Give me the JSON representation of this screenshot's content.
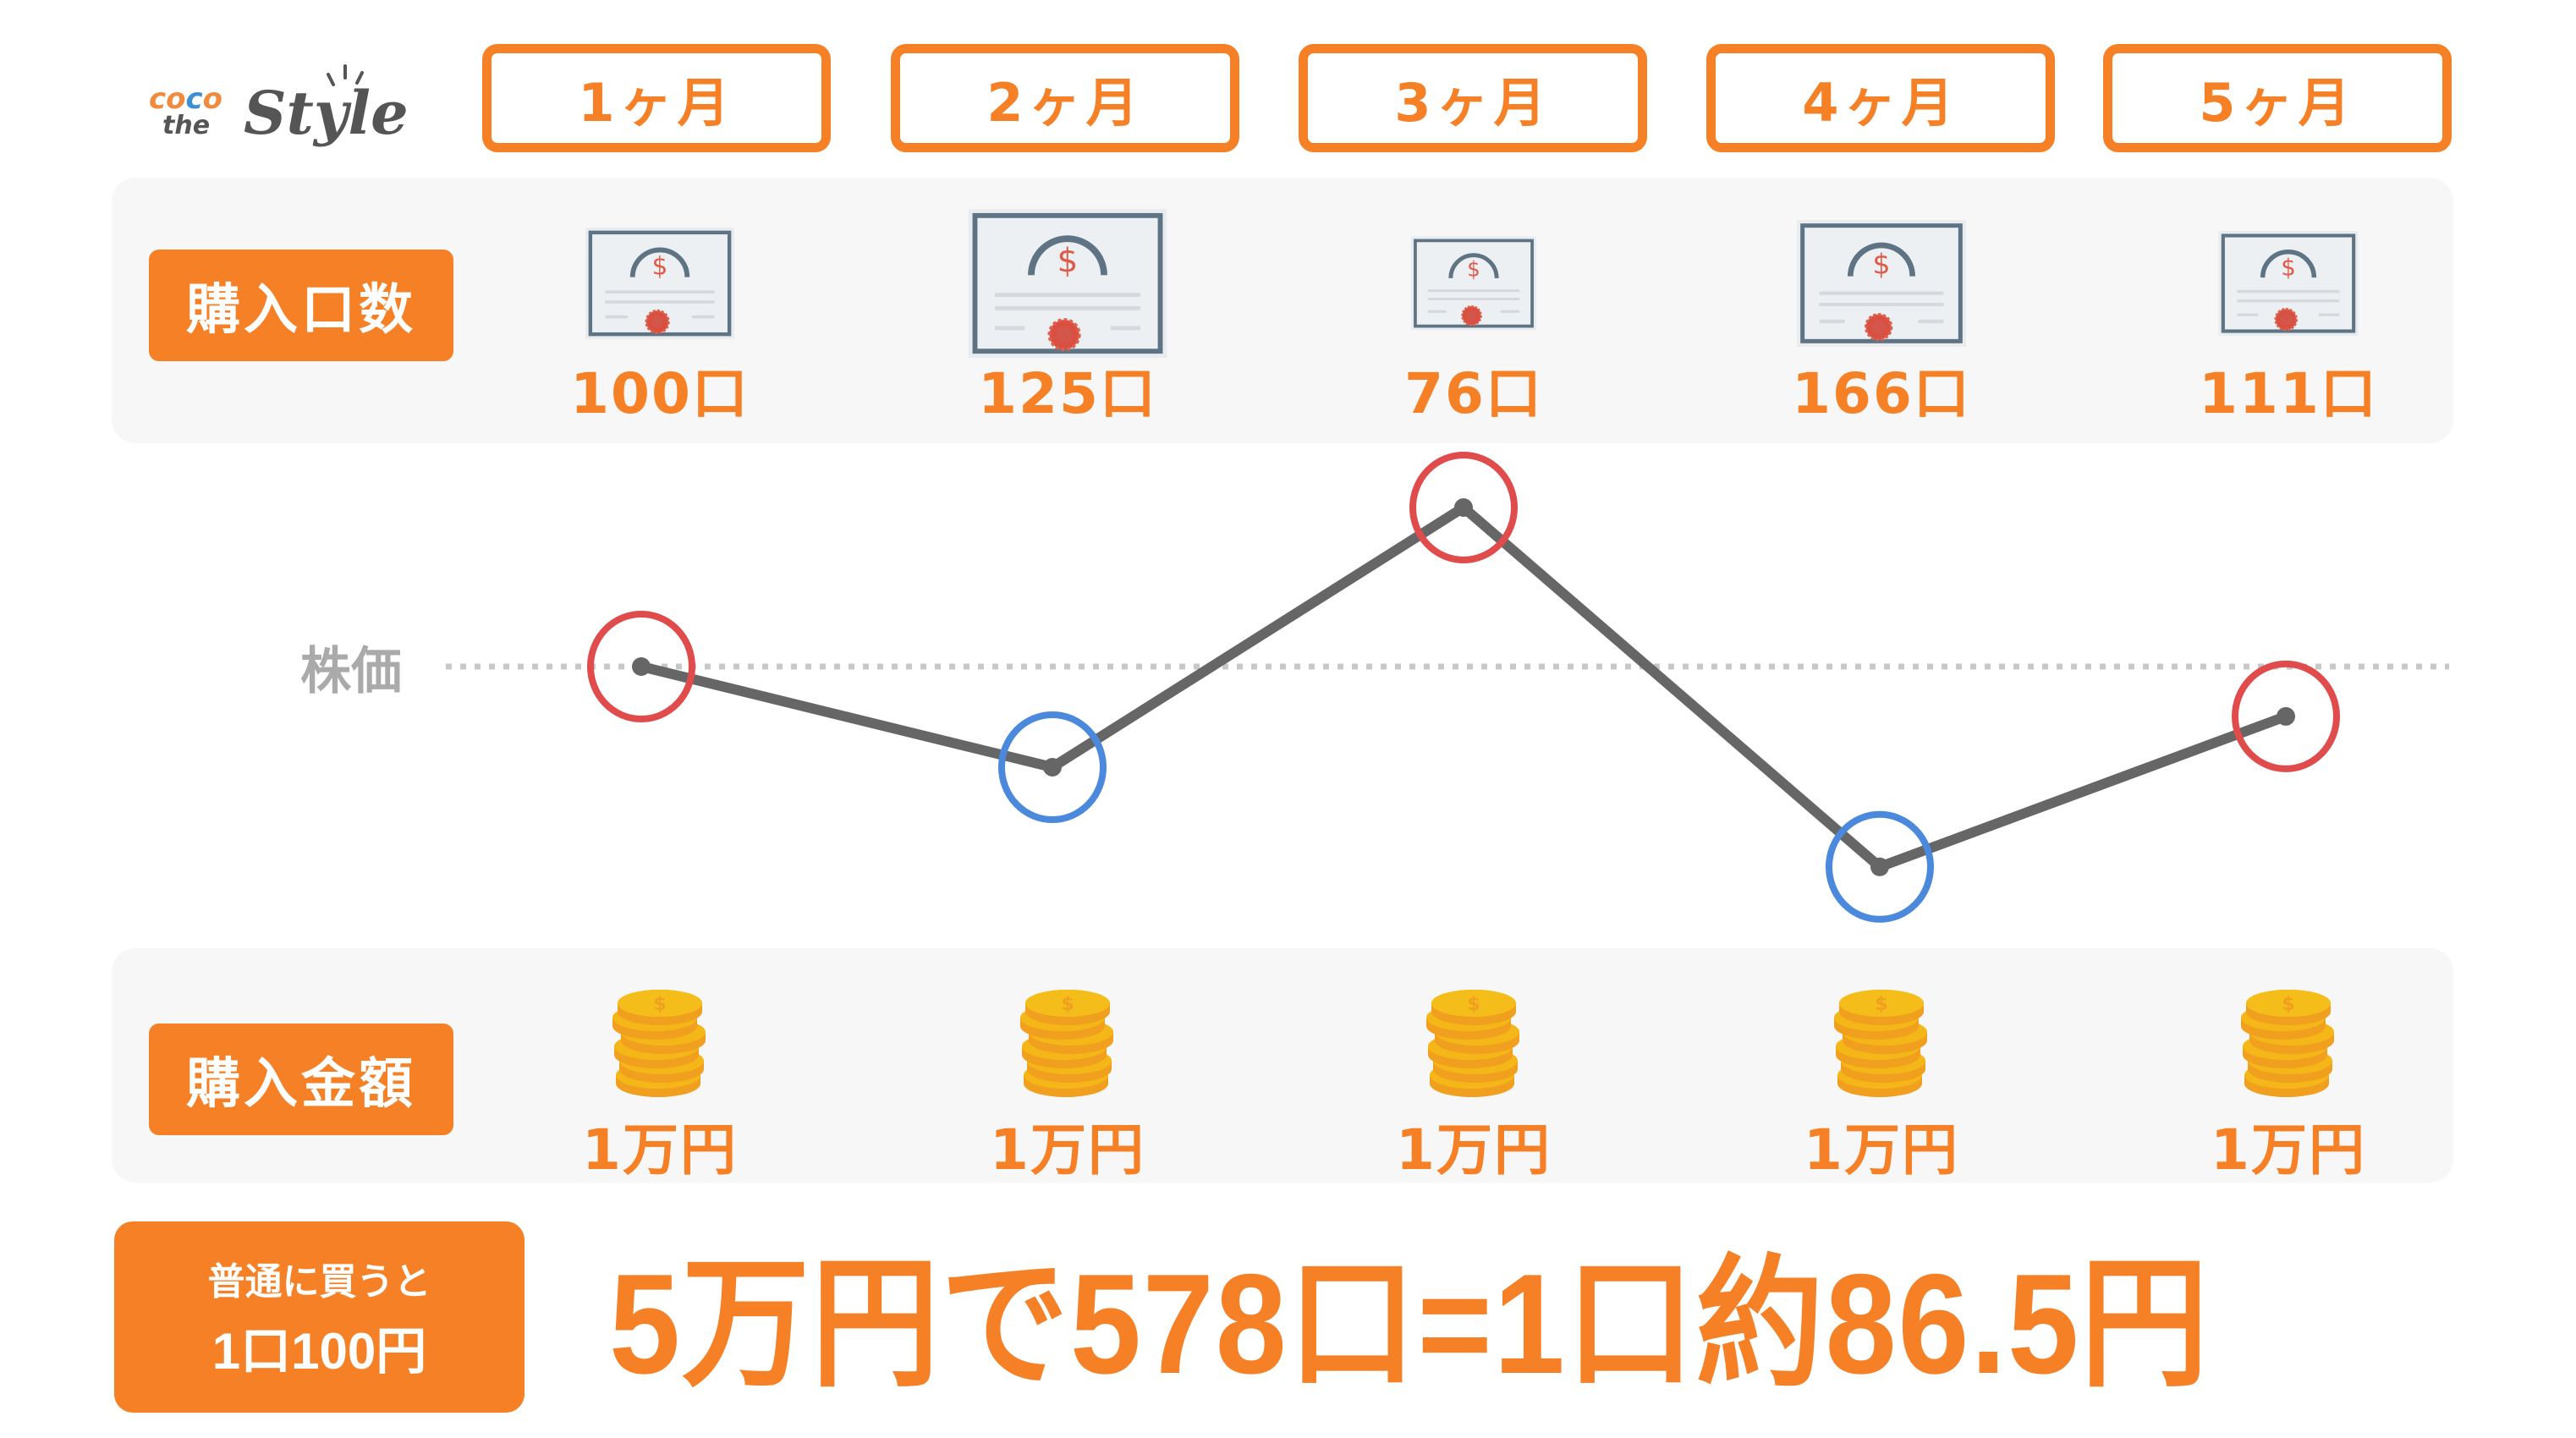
{
  "logo": {
    "part1": "coco",
    "part2": "the",
    "part3": "Style"
  },
  "months": [
    "1ヶ月",
    "2ヶ月",
    "3ヶ月",
    "4ヶ月",
    "5ヶ月"
  ],
  "rows": {
    "shares": {
      "label": "購入口数",
      "values": [
        "100口",
        "125口",
        "76口",
        "166口",
        "111口"
      ],
      "icon": "stock-certificate-icon"
    },
    "amount": {
      "label": "購入金額",
      "values": [
        "1万円",
        "1万円",
        "1万円",
        "1万円",
        "1万円"
      ],
      "icon": "coin-stack-icon"
    }
  },
  "price_label": "株価",
  "normal_purchase": {
    "line1": "普通に買うと",
    "line2": "1口100円"
  },
  "summary": "5万円で578口=1口約86.5円",
  "colors": {
    "accent": "#f58025",
    "high": "#e04b4b",
    "low": "#4a89dc",
    "line": "#666666",
    "baseline": "#c8c8c8"
  },
  "chart_data": {
    "type": "line",
    "title": "",
    "xlabel": "",
    "ylabel": "株価",
    "categories": [
      "1ヶ月",
      "2ヶ月",
      "3ヶ月",
      "4ヶ月",
      "5ヶ月"
    ],
    "series": [
      {
        "name": "株価",
        "values": [
          100,
          80,
          131.6,
          60.2,
          90.1
        ]
      }
    ],
    "baseline": 100,
    "markers": [
      "high",
      "low",
      "high",
      "low",
      "high"
    ],
    "ylim": [
      40,
      160
    ],
    "grid": false,
    "legend": "none"
  }
}
